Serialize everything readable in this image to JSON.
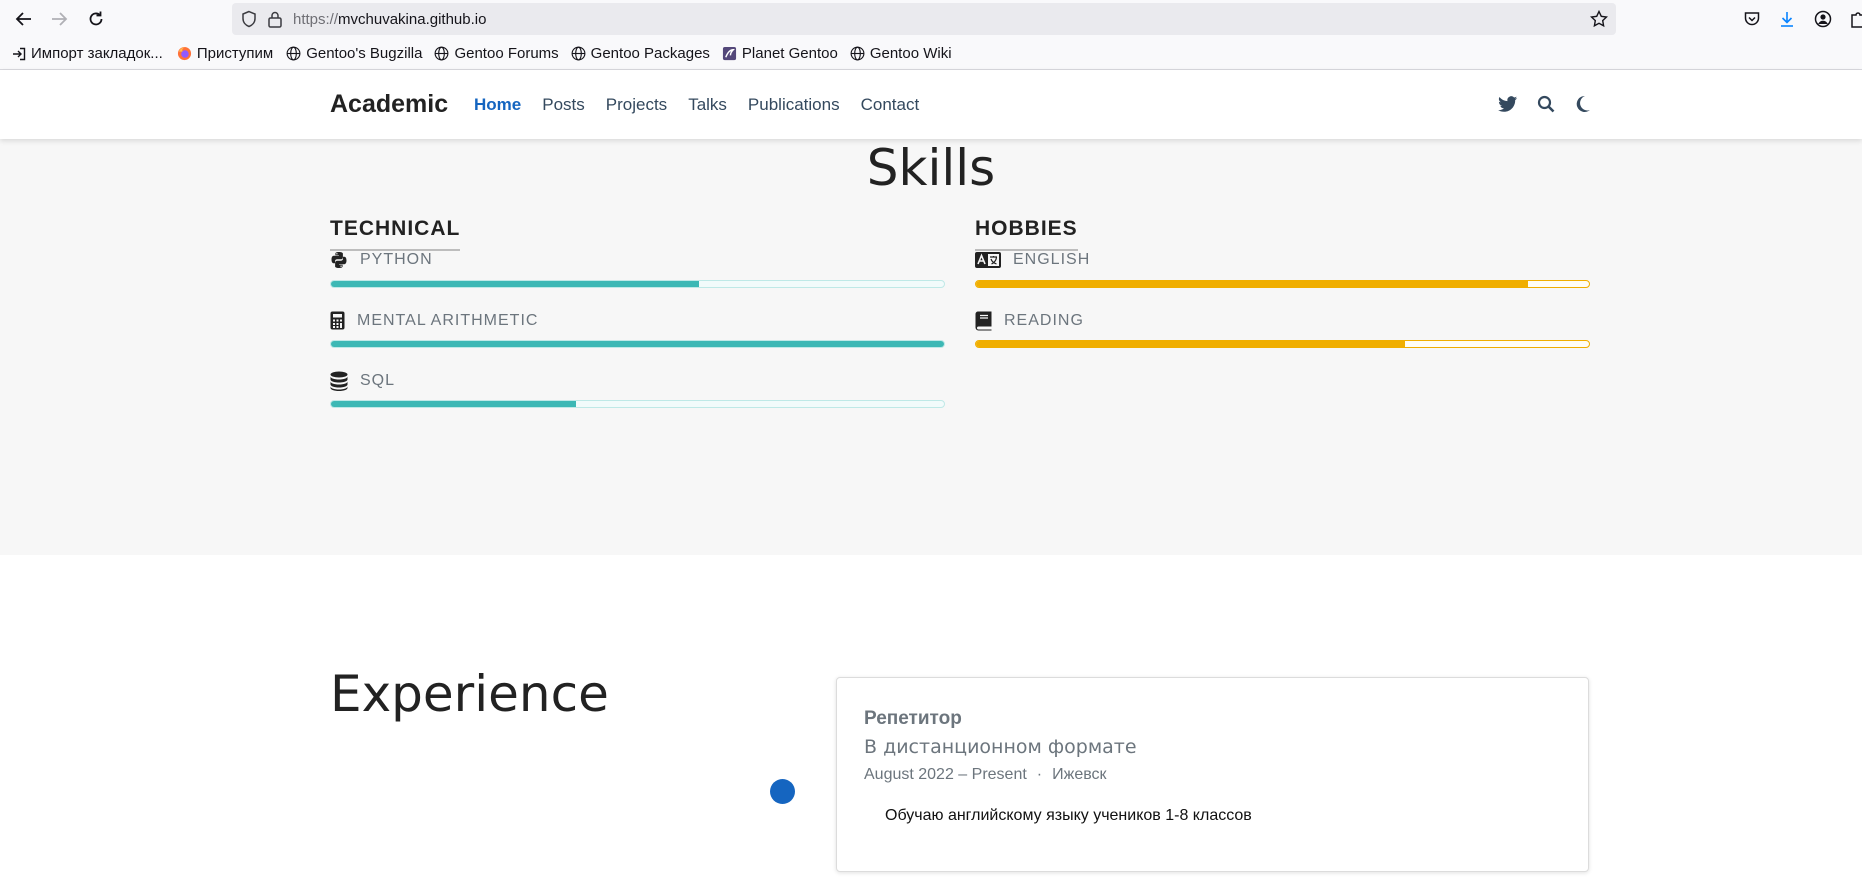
{
  "browser": {
    "url_scheme": "https://",
    "url_host": "mvchuvakina.github.io",
    "bookmarks": [
      {
        "label": "Импорт закладок..."
      },
      {
        "label": "Приступим"
      },
      {
        "label": "Gentoo's Bugzilla"
      },
      {
        "label": "Gentoo Forums"
      },
      {
        "label": "Gentoo Packages"
      },
      {
        "label": "Planet Gentoo"
      },
      {
        "label": "Gentoo Wiki"
      }
    ]
  },
  "site": {
    "brand": "Academic",
    "menu": [
      "Home",
      "Posts",
      "Projects",
      "Talks",
      "Publications",
      "Contact"
    ],
    "active_menu": "Home"
  },
  "skills": {
    "title": "Skills",
    "technical": {
      "heading": "TECHNICAL",
      "items": [
        {
          "label": "PYTHON",
          "icon": "python-icon",
          "level": 0.6
        },
        {
          "label": "MENTAL ARITHMETIC",
          "icon": "calculator-icon",
          "level": 1.0
        },
        {
          "label": "SQL",
          "icon": "database-icon",
          "level": 0.4
        }
      ]
    },
    "hobbies": {
      "heading": "HOBBIES",
      "items": [
        {
          "label": "ENGLISH",
          "icon": "language-icon",
          "level": 0.9
        },
        {
          "label": "READING",
          "icon": "book-icon",
          "level": 0.7
        }
      ]
    }
  },
  "experience": {
    "title": "Experience",
    "card": {
      "role": "Репетитор",
      "org": "В дистанционном формате",
      "dates": "August 2022 – Present",
      "separator": "·",
      "location": "Ижевск",
      "description": "Обучаю английскому языку учеников 1-8 классов"
    }
  },
  "colors": {
    "accent": "#1565c0",
    "technical_bar": "#3cb8b5",
    "hobbies_bar": "#f0ae00"
  }
}
